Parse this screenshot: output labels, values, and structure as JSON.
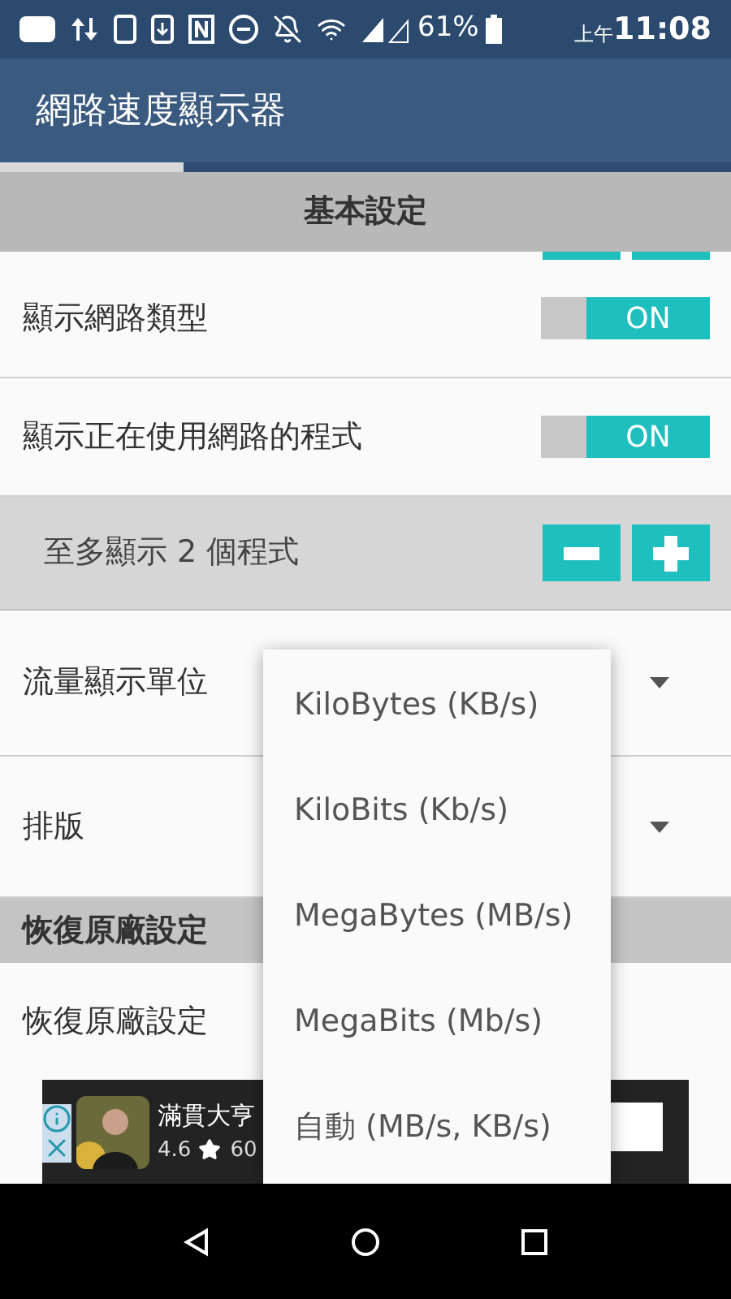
{
  "status_bar": {
    "battery": "61%",
    "period": "上午",
    "time": "11:08"
  },
  "app_bar": {
    "title": "網路速度顯示器"
  },
  "tabs": [
    {
      "selected": true
    },
    {
      "selected": false
    }
  ],
  "section_header": "基本設定",
  "rows": [
    {
      "kind": "toggle",
      "label": "顯示網路類型",
      "on": true,
      "on_text": "ON"
    },
    {
      "kind": "toggle",
      "label": "顯示正在使用網路的程式",
      "on": true,
      "on_text": "ON"
    },
    {
      "kind": "stepper",
      "label": "至多顯示 2 個程式"
    },
    {
      "kind": "dropdown",
      "label": "流量顯示單位"
    },
    {
      "kind": "dropdown",
      "label": "排版"
    },
    {
      "kind": "header",
      "label": "恢復原廠設定"
    },
    {
      "kind": "plain",
      "label": "恢復原廠設定"
    }
  ],
  "ad": {
    "title": "滿貫大亨",
    "rating": "4.6",
    "count": "60"
  },
  "menu": {
    "options": [
      "KiloBytes (KB/s)",
      "KiloBits (Kb/s)",
      "MegaBytes (MB/s)",
      "MegaBits (Mb/s)",
      "自動 (MB/s, KB/s)"
    ]
  }
}
